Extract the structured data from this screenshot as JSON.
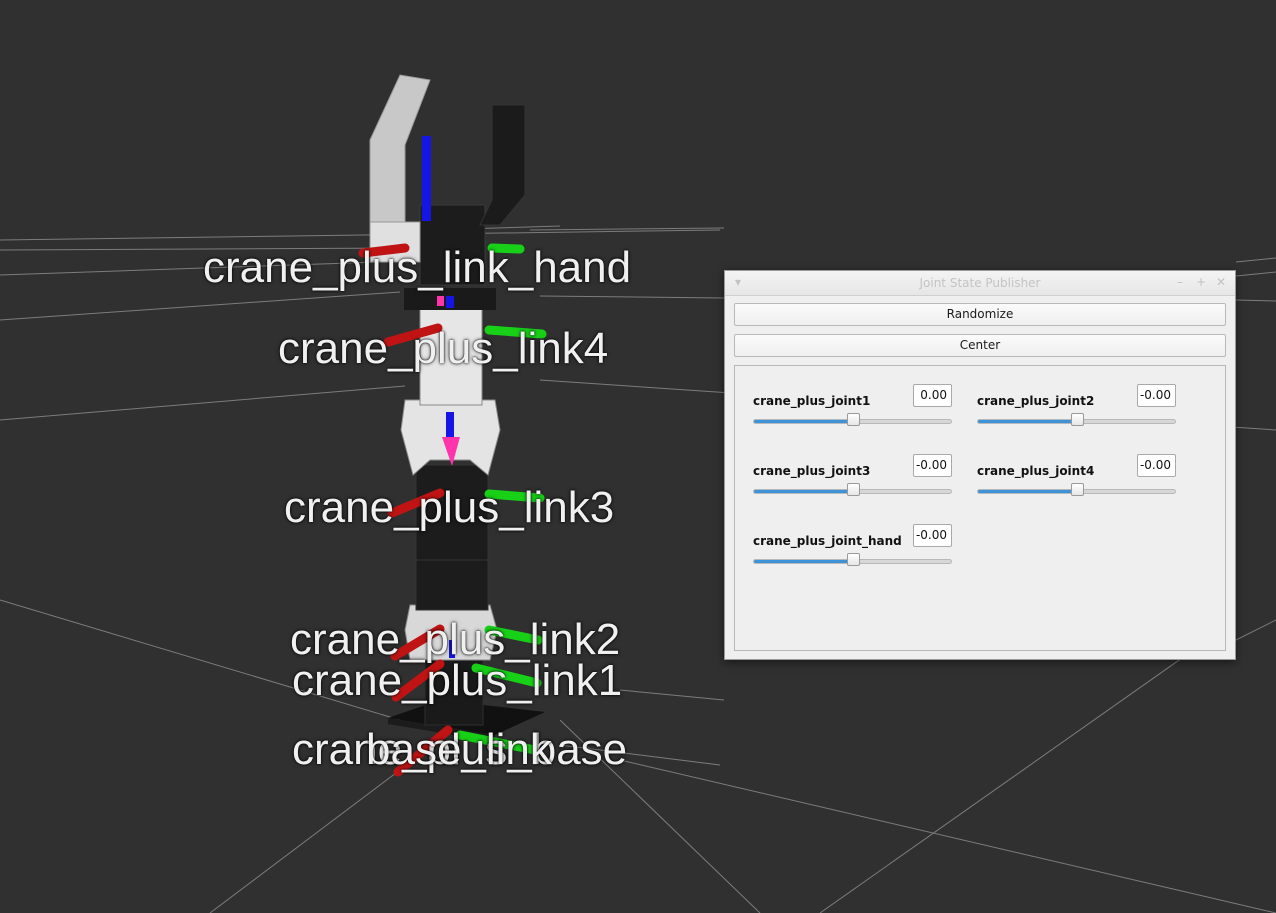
{
  "viewport": {
    "frame_labels": [
      "crane_plus_link_hand",
      "crane_plus_link4",
      "crane_plus_link3",
      "crane_plus_link2",
      "crane_plus_link1",
      "crane_plus_base",
      "base_link"
    ],
    "background_color": "#303030",
    "axis_colors": {
      "x": "#cc1010",
      "y": "#10d010",
      "z": "#1010e0"
    }
  },
  "joint_state_publisher": {
    "title": "Joint State Publisher",
    "randomize_label": "Randomize",
    "center_label": "Center",
    "titlebar_icons": [
      "menu-icon",
      "minimize-icon",
      "maximize-icon",
      "close-icon"
    ],
    "titlebar_glyphs": {
      "menu": "▾",
      "minimize": "–",
      "maximize": "+",
      "close": "✕"
    },
    "joints": [
      {
        "name": "crane_plus_joint1",
        "value": "0.00",
        "slider_fraction": 0.5
      },
      {
        "name": "crane_plus_joint2",
        "value": "-0.00",
        "slider_fraction": 0.5
      },
      {
        "name": "crane_plus_joint3",
        "value": "-0.00",
        "slider_fraction": 0.5
      },
      {
        "name": "crane_plus_joint4",
        "value": "-0.00",
        "slider_fraction": 0.5
      },
      {
        "name": "crane_plus_joint_hand",
        "value": "-0.00",
        "slider_fraction": 0.5
      }
    ],
    "accent_color": "#3e93d8"
  }
}
